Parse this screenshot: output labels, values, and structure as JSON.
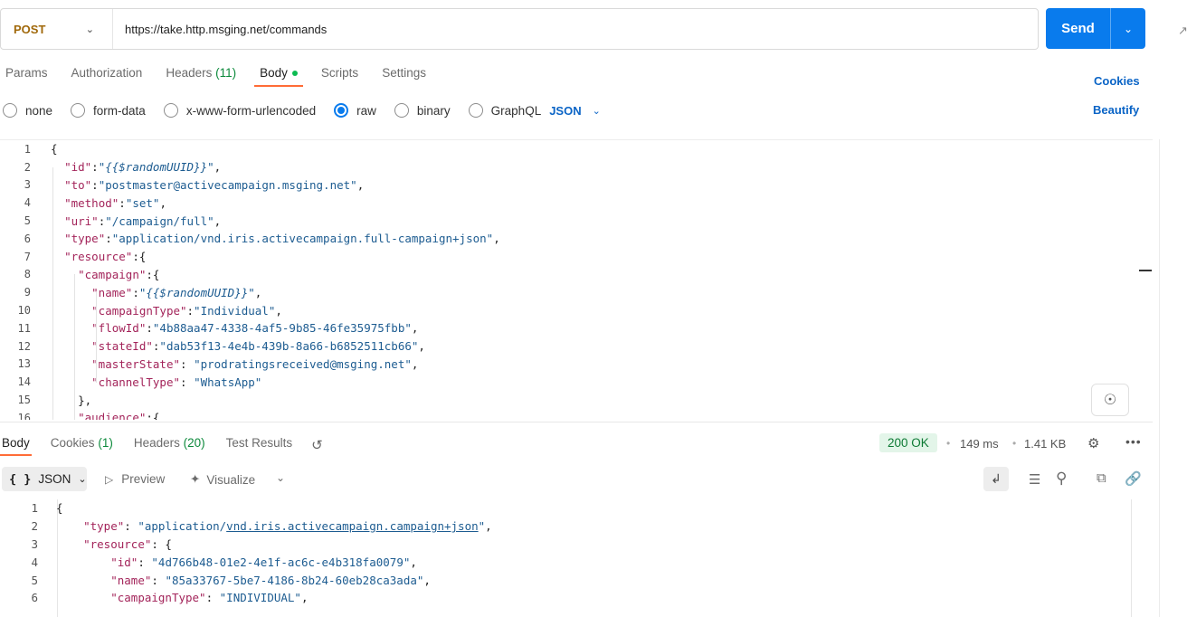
{
  "request": {
    "method": "POST",
    "url": "https://take.http.msging.net/commands",
    "send_label": "Send"
  },
  "request_tabs": {
    "params": "Params",
    "authorization": "Authorization",
    "headers": "Headers",
    "headers_count": "(11)",
    "body": "Body",
    "scripts": "Scripts",
    "settings": "Settings",
    "cookies": "Cookies",
    "beautify": "Beautify"
  },
  "body_types": {
    "none": "none",
    "form_data": "form-data",
    "urlencoded": "x-www-form-urlencoded",
    "raw": "raw",
    "binary": "binary",
    "graphql": "GraphQL",
    "format": "JSON",
    "selected": "raw"
  },
  "editor": {
    "line_numbers": [
      "1",
      "2",
      "3",
      "4",
      "5",
      "6",
      "7",
      "8",
      "9",
      "10",
      "11",
      "12",
      "13",
      "14",
      "15",
      "16"
    ],
    "l1": "{",
    "l2_key": "\"id\"",
    "l2_val": "{{$randomUUID}}",
    "l3_key": "\"to\"",
    "l3_val": "\"postmaster@activecampaign.msging.net\"",
    "l4_key": "\"method\"",
    "l4_val": "\"set\"",
    "l5_key": "\"uri\"",
    "l5_val": "\"/campaign/full\"",
    "l6_key": "\"type\"",
    "l6_val": "\"application/vnd.iris.activecampaign.full-campaign+json\"",
    "l7_key": "\"resource\"",
    "l8_key": "\"campaign\"",
    "l9_key": "\"name\"",
    "l9_val": "{{$randomUUID}}",
    "l10_key": "\"campaignType\"",
    "l10_val": "\"Individual\"",
    "l11_key": "\"flowId\"",
    "l11_val": "\"4b88aa47-4338-4af5-9b85-46fe35975fbb\"",
    "l12_key": "\"stateId\"",
    "l12_val": "\"dab53f13-4e4b-439b-8a66-b6852511cb66\"",
    "l13_key": "\"masterState\"",
    "l13_val": "\"prodratingsreceived@msging.net\"",
    "l14_key": "\"channelType\"",
    "l14_val": "\"WhatsApp\"",
    "l15": "},",
    "l16_key": "\"audience\""
  },
  "response_tabs": {
    "body": "Body",
    "cookies": "Cookies",
    "cookies_count": "(1)",
    "headers": "Headers",
    "headers_count": "(20)",
    "test_results": "Test Results"
  },
  "response_meta": {
    "status": "200 OK",
    "time": "149 ms",
    "size": "1.41 KB"
  },
  "response_toolbar": {
    "format": "JSON",
    "preview": "Preview",
    "visualize": "Visualize"
  },
  "response": {
    "line_numbers": [
      "1",
      "2",
      "3",
      "4",
      "5",
      "6"
    ],
    "l1": "{",
    "l2_key": "\"type\"",
    "l2_val_a": "\"application/",
    "l2_val_b": "vnd.iris.activecampaign.campaign+json",
    "l2_val_c": "\"",
    "l3_key": "\"resource\"",
    "l4_key": "\"id\"",
    "l4_val": "\"4d766b48-01e2-4e1f-ac6c-e4b318fa0079\"",
    "l5_key": "\"name\"",
    "l5_val": "\"85a33767-5be7-4186-8b24-60eb28ca3ada\"",
    "l6_key": "\"campaignType\"",
    "l6_val": "\"INDIVIDUAL\""
  },
  "colors": {
    "accent": "#097bed",
    "tab_underline": "#ff6c37",
    "method": "#a0680a",
    "json_key": "#a3245a",
    "json_string": "#1d5c91",
    "status_ok": "#0d7a34"
  }
}
